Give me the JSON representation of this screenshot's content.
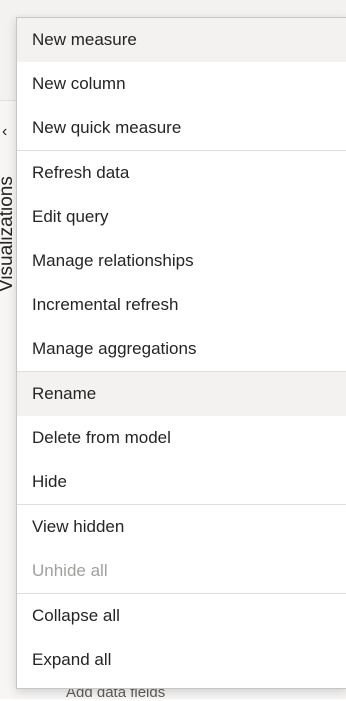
{
  "background": {
    "collapse_glyph": "‹",
    "pane_label": "Visualizations",
    "bottom_text": "Add data fields"
  },
  "menu": {
    "groups": [
      [
        "New measure",
        "New column",
        "New quick measure"
      ],
      [
        "Refresh data",
        "Edit query",
        "Manage relationships",
        "Incremental refresh",
        "Manage aggregations"
      ],
      [
        "Rename",
        "Delete from model",
        "Hide"
      ],
      [
        "View hidden",
        "Unhide all"
      ],
      [
        "Collapse all",
        "Expand all"
      ]
    ],
    "highlighted": [
      "New measure",
      "Rename"
    ],
    "disabled": [
      "Unhide all"
    ]
  }
}
